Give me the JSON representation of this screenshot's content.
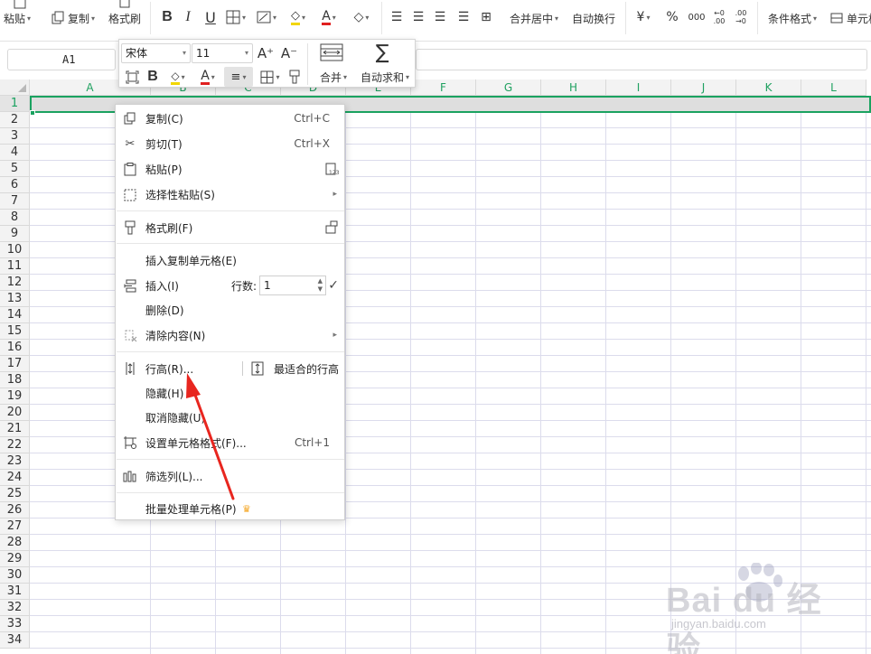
{
  "ribbon": {
    "paste": "粘贴",
    "copy": "复制",
    "format_painter": "格式刷",
    "merge_center": "合并居中",
    "wrap_text": "自动换行",
    "currency_symbol": "¥",
    "percent_symbol": "%",
    "thousands_symbol": "000",
    "decimal_inc": "←0 .00",
    "decimal_dec": ".00 →0",
    "cond_format": "条件格式",
    "cell_style": "单元格"
  },
  "formula_bar": {
    "name_box": "A1"
  },
  "columns": [
    "A",
    "B",
    "C",
    "D",
    "E",
    "F",
    "G",
    "H",
    "I",
    "J",
    "K",
    "L"
  ],
  "rows": [
    "1",
    "2",
    "3",
    "4",
    "5",
    "6",
    "7",
    "8",
    "9",
    "10",
    "11",
    "12",
    "13",
    "14",
    "15",
    "16",
    "17",
    "18",
    "19",
    "20",
    "21",
    "22",
    "23",
    "24",
    "25",
    "26",
    "27",
    "28",
    "29",
    "30",
    "31",
    "32",
    "33",
    "34"
  ],
  "mini_toolbar": {
    "font_name": "宋体",
    "font_size": "11",
    "grow_font": "A⁺",
    "shrink_font": "A⁻",
    "merge_label": "合并",
    "autosum_label": "自动求和"
  },
  "context_menu": {
    "copy": {
      "label": "复制(C)",
      "shortcut": "Ctrl+C"
    },
    "cut": {
      "label": "剪切(T)",
      "shortcut": "Ctrl+X"
    },
    "paste": {
      "label": "粘贴(P)"
    },
    "paste_special": {
      "label": "选择性粘贴(S)"
    },
    "format_painter": {
      "label": "格式刷(F)"
    },
    "insert_copied": {
      "label": "插入复制单元格(E)"
    },
    "insert": {
      "label": "插入(I)",
      "rows_label": "行数:",
      "rows_value": "1"
    },
    "delete": {
      "label": "删除(D)"
    },
    "clear": {
      "label": "清除内容(N)"
    },
    "row_height": {
      "label": "行高(R)...",
      "best_fit": "最适合的行高"
    },
    "hide": {
      "label": "隐藏(H)"
    },
    "unhide": {
      "label": "取消隐藏(U)"
    },
    "format_cells": {
      "label": "设置单元格格式(F)...",
      "shortcut": "Ctrl+1"
    },
    "filter_col": {
      "label": "筛选列(L)..."
    },
    "batch": {
      "label": "批量处理单元格(P)"
    }
  },
  "watermark": {
    "brand": "Bai du 经验",
    "url": "jingyan.baidu.com"
  },
  "colors": {
    "accent_green": "#1aa260",
    "arrow_red": "#e8261f",
    "crown_gold": "#f5a623"
  }
}
